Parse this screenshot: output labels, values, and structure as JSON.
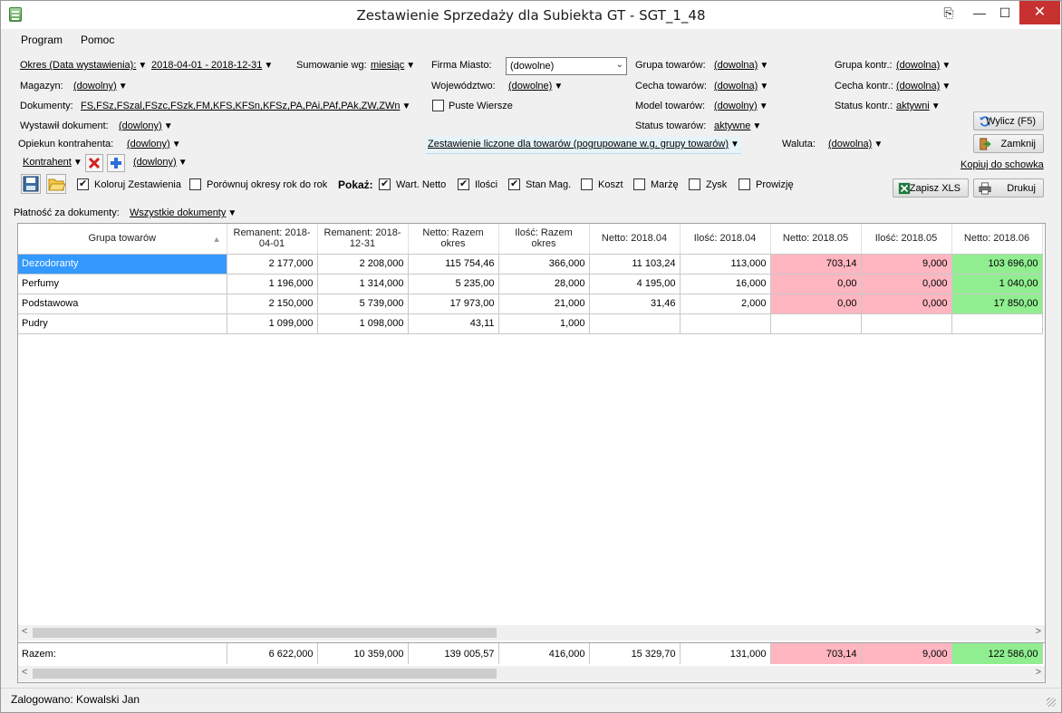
{
  "window": {
    "title": "Zestawienie Sprzedaży dla Subiekta GT - SGT_1_48",
    "btn_extra": "⎘",
    "btn_min": "—",
    "btn_max": "☐",
    "btn_close": "✕"
  },
  "menu": {
    "program": "Program",
    "pomoc": "Pomoc"
  },
  "filters": {
    "okres_label": "Okres (Data wystawienia):",
    "okres_value": "2018-04-01 - 2018-12-31",
    "sumowanie_label": "Sumowanie wg:",
    "sumowanie_value": "miesiąc",
    "firma_miasto_label": "Firma Miasto:",
    "firma_miasto_value": "(dowolne)",
    "grupa_towarow_label": "Grupa towarów:",
    "grupa_towarow_value": "(dowolna)",
    "grupa_kontr_label": "Grupa kontr.:",
    "grupa_kontr_value": "(dowolna)",
    "magazyn_label": "Magazyn:",
    "magazyn_value": "(dowolny)",
    "wojewodztwo_label": "Województwo:",
    "wojewodztwo_value": "(dowolne)",
    "cecha_towarow_label": "Cecha towarów:",
    "cecha_towarow_value": "(dowolna)",
    "cecha_kontr_label": "Cecha kontr.:",
    "cecha_kontr_value": "(dowolna)",
    "dokumenty_label": "Dokumenty:",
    "dokumenty_value": "FS,FSz,FSzal,FSzc,FSzk,FM,KFS,KFSn,KFSz,PA,PAi,PAf,PAk,ZW,ZWn",
    "puste_wiersze": "Puste Wiersze",
    "model_towarow_label": "Model towarów:",
    "model_towarow_value": "(dowolny)",
    "status_kontr_label": "Status kontr.:",
    "status_kontr_value": "aktywni",
    "wystawil_label": "Wystawił dokument:",
    "wystawil_value": "(dowlony)",
    "status_towarow_label": "Status towarów:",
    "status_towarow_value": "aktywne",
    "opiekun_label": "Opiekun kontrahenta:",
    "opiekun_value": "(dowlony)",
    "zestawienie_link": "Zestawienie liczone dla towarów (pogrupowane w.g. grupy towarów)",
    "waluta_label": "Waluta:",
    "waluta_value": "(dowolna)",
    "kontrahent_label": "Kontrahent",
    "kontrahent_value": "(dowlony)",
    "platnosc_label": "Płatność za dokumenty:",
    "platnosc_value": "Wszystkie dokumenty"
  },
  "options": {
    "koloruj": "Koloruj Zestawienia",
    "porownaj": "Porównuj okresy rok do rok",
    "pokaz_label": "Pokaż:",
    "wart_netto": "Wart. Netto",
    "ilosci": "Ilości",
    "stan_mag": "Stan Mag.",
    "koszt": "Koszt",
    "marze": "Marżę",
    "zysk": "Zysk",
    "prowizje": "Prowizję"
  },
  "buttons": {
    "wylicz": "Wylicz (F5)",
    "zamknij": "Zamknij",
    "kopiuj": "Kopiuj do schowka",
    "zapisz_xls": "Zapisz XLS",
    "drukuj": "Drukuj"
  },
  "grid": {
    "headers": [
      "Grupa towarów",
      "Remanent: 2018-04-01",
      "Remanent: 2018-12-31",
      "Netto: Razem okres",
      "Ilość: Razem okres",
      "Netto: 2018.04",
      "Ilość: 2018.04",
      "Netto: 2018.05",
      "Ilość: 2018.05",
      "Netto: 2018.06"
    ],
    "sort_icon": "sort-ascending-icon",
    "rows": [
      [
        "Dezodoranty",
        "2 177,000",
        "2 208,000",
        "115 754,46",
        "366,000",
        "11 103,24",
        "113,000",
        "703,14",
        "9,000",
        "103 696,00"
      ],
      [
        "Perfumy",
        "1 196,000",
        "1 314,000",
        "5 235,00",
        "28,000",
        "4 195,00",
        "16,000",
        "0,00",
        "0,000",
        "1 040,00"
      ],
      [
        "Podstawowa",
        "2 150,000",
        "5 739,000",
        "17 973,00",
        "21,000",
        "31,46",
        "2,000",
        "0,00",
        "0,000",
        "17 850,00"
      ],
      [
        "Pudry",
        "1 099,000",
        "1 098,000",
        "43,11",
        "1,000",
        "",
        "",
        "",
        "",
        ""
      ]
    ],
    "totals": [
      "Razem:",
      "6 622,000",
      "10 359,000",
      "139 005,57",
      "416,000",
      "15 329,70",
      "131,000",
      "703,14",
      "9,000",
      "122 586,00"
    ],
    "colors": {
      "negative": "#ffb6c1",
      "positive": "#90ee90",
      "selected": "#3399ff"
    }
  },
  "status": {
    "logged_in": "Zalogowano: Kowalski Jan"
  }
}
